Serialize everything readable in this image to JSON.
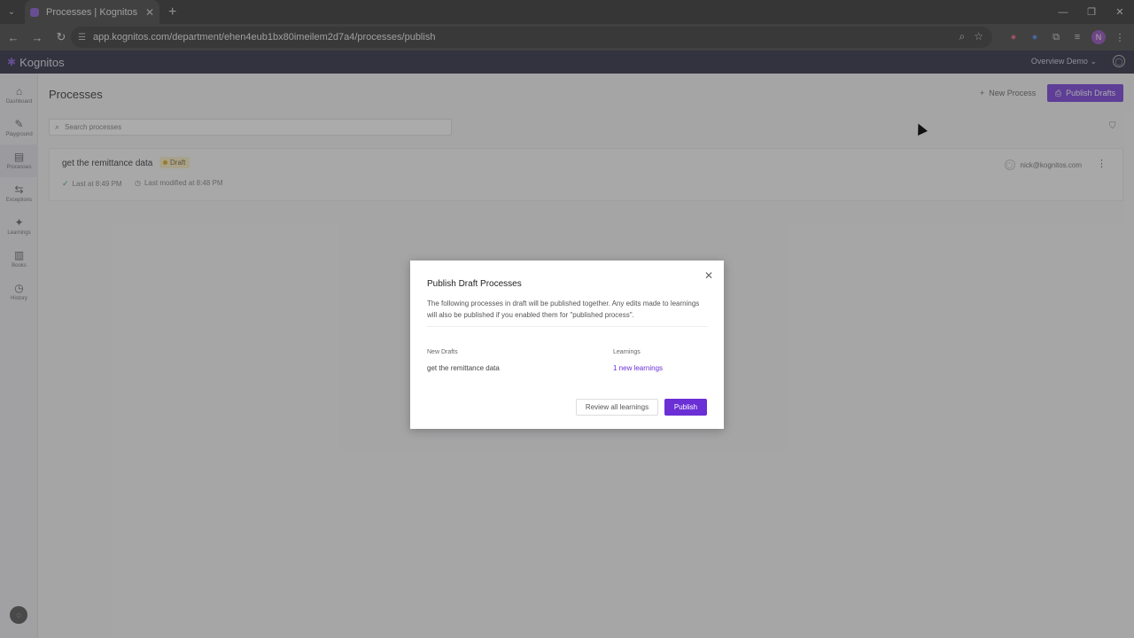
{
  "browser": {
    "tab_title": "Processes | Kognitos",
    "url": "app.kognitos.com/department/ehen4eub1bx80imeilem2d7a4/processes/publish"
  },
  "app": {
    "brand": "Kognitos",
    "workspace": "Overview Demo"
  },
  "sidebar": {
    "items": [
      {
        "label": "Dashboard",
        "icon": "home-icon"
      },
      {
        "label": "Playground",
        "icon": "edit-icon"
      },
      {
        "label": "Processes",
        "icon": "processes-icon"
      },
      {
        "label": "Exceptions",
        "icon": "exceptions-icon"
      },
      {
        "label": "Learnings",
        "icon": "sparkle-icon"
      },
      {
        "label": "Books",
        "icon": "books-icon"
      },
      {
        "label": "History",
        "icon": "clock-icon"
      }
    ]
  },
  "main": {
    "title": "Processes",
    "new_process_label": "New Process",
    "publish_drafts_label": "Publish Drafts",
    "search_placeholder": "Search processes",
    "process": {
      "name": "get the remittance data",
      "status": "Draft",
      "last_run": "Last at 8:49 PM",
      "last_modified": "Last modified at 8:48 PM",
      "owner": "nick@kognitos.com"
    }
  },
  "modal": {
    "title": "Publish Draft Processes",
    "description": "The following processes in draft will be published together. Any edits made to learnings will also be published if you enabled them for \"published process\".",
    "col_drafts": "New Drafts",
    "col_learnings": "Learnings",
    "draft_name": "get the remittance data",
    "learnings_link": "1 new learnings",
    "review_label": "Review all learnings",
    "publish_label": "Publish"
  },
  "colors": {
    "accent": "#6b2fd6",
    "header_bg": "#1a1730",
    "draft_badge": "#fbeec2"
  }
}
